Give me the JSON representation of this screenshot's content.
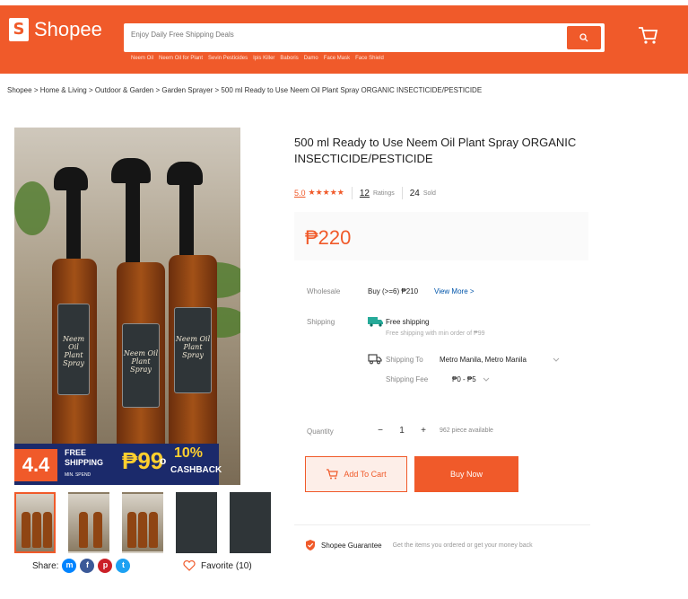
{
  "header": {
    "logo_text": "Shopee",
    "search_placeholder": "Enjoy Daily Free Shipping Deals",
    "quick_links": [
      "Neem Oil",
      "Neem Oil for Plant",
      "Sevin Pesticides",
      "Ipis Killer",
      "Baboris",
      "Damo",
      "Face Mask",
      "Face Shield"
    ]
  },
  "breadcrumb": [
    "Shopee",
    "Home & Living",
    "Outdoor & Garden",
    "Garden Sprayer",
    "500 ml Ready to Use Neem Oil Plant Spray ORGANIC INSECTICIDE/PESTICIDE"
  ],
  "product": {
    "title": "500 ml Ready to Use Neem Oil Plant Spray ORGANIC INSECTICIDE/PESTICIDE",
    "rating": "5.0",
    "stars": "★★★★★",
    "ratings_count": "12",
    "ratings_label": "Ratings",
    "sold_count": "24",
    "sold_label": "Sold",
    "price": "₱220",
    "bottle_label": "Neem Oil Plant Spray"
  },
  "details": {
    "wholesale_label": "Wholesale",
    "wholesale_value": "Buy (>=6) ₱210",
    "view_more": "View More >",
    "shipping_label": "Shipping",
    "free_shipping": "Free shipping",
    "free_shipping_note": "Free shipping with min order of ₱99",
    "shipping_to_label": "Shipping To",
    "shipping_to_value": "Metro Manila, Metro Manila",
    "shipping_fee_label": "Shipping Fee",
    "shipping_fee_value": "₱0 - ₱5",
    "quantity_label": "Quantity",
    "quantity_minus": "−",
    "quantity_value": "1",
    "quantity_plus": "+",
    "available": "962 piece available"
  },
  "buttons": {
    "add_to_cart": "Add To Cart",
    "buy_now": "Buy Now"
  },
  "guarantee": {
    "title": "Shopee Guarantee",
    "text": "Get the items you ordered or get your money back"
  },
  "promo": {
    "sale": "4.4",
    "free": "FREE",
    "shipping": "SHIPPING",
    "min_spend": "MIN. SPEND",
    "amount": "₱99",
    "connector": "o",
    "percent": "10%",
    "cashback": "CASHBACK"
  },
  "social": {
    "share_label": "Share:",
    "favorite_label": "Favorite (10)"
  },
  "colors": {
    "brand": "#f05a2a",
    "promo_bg": "#1b2a6b",
    "promo_accent": "#ffcf2e"
  }
}
